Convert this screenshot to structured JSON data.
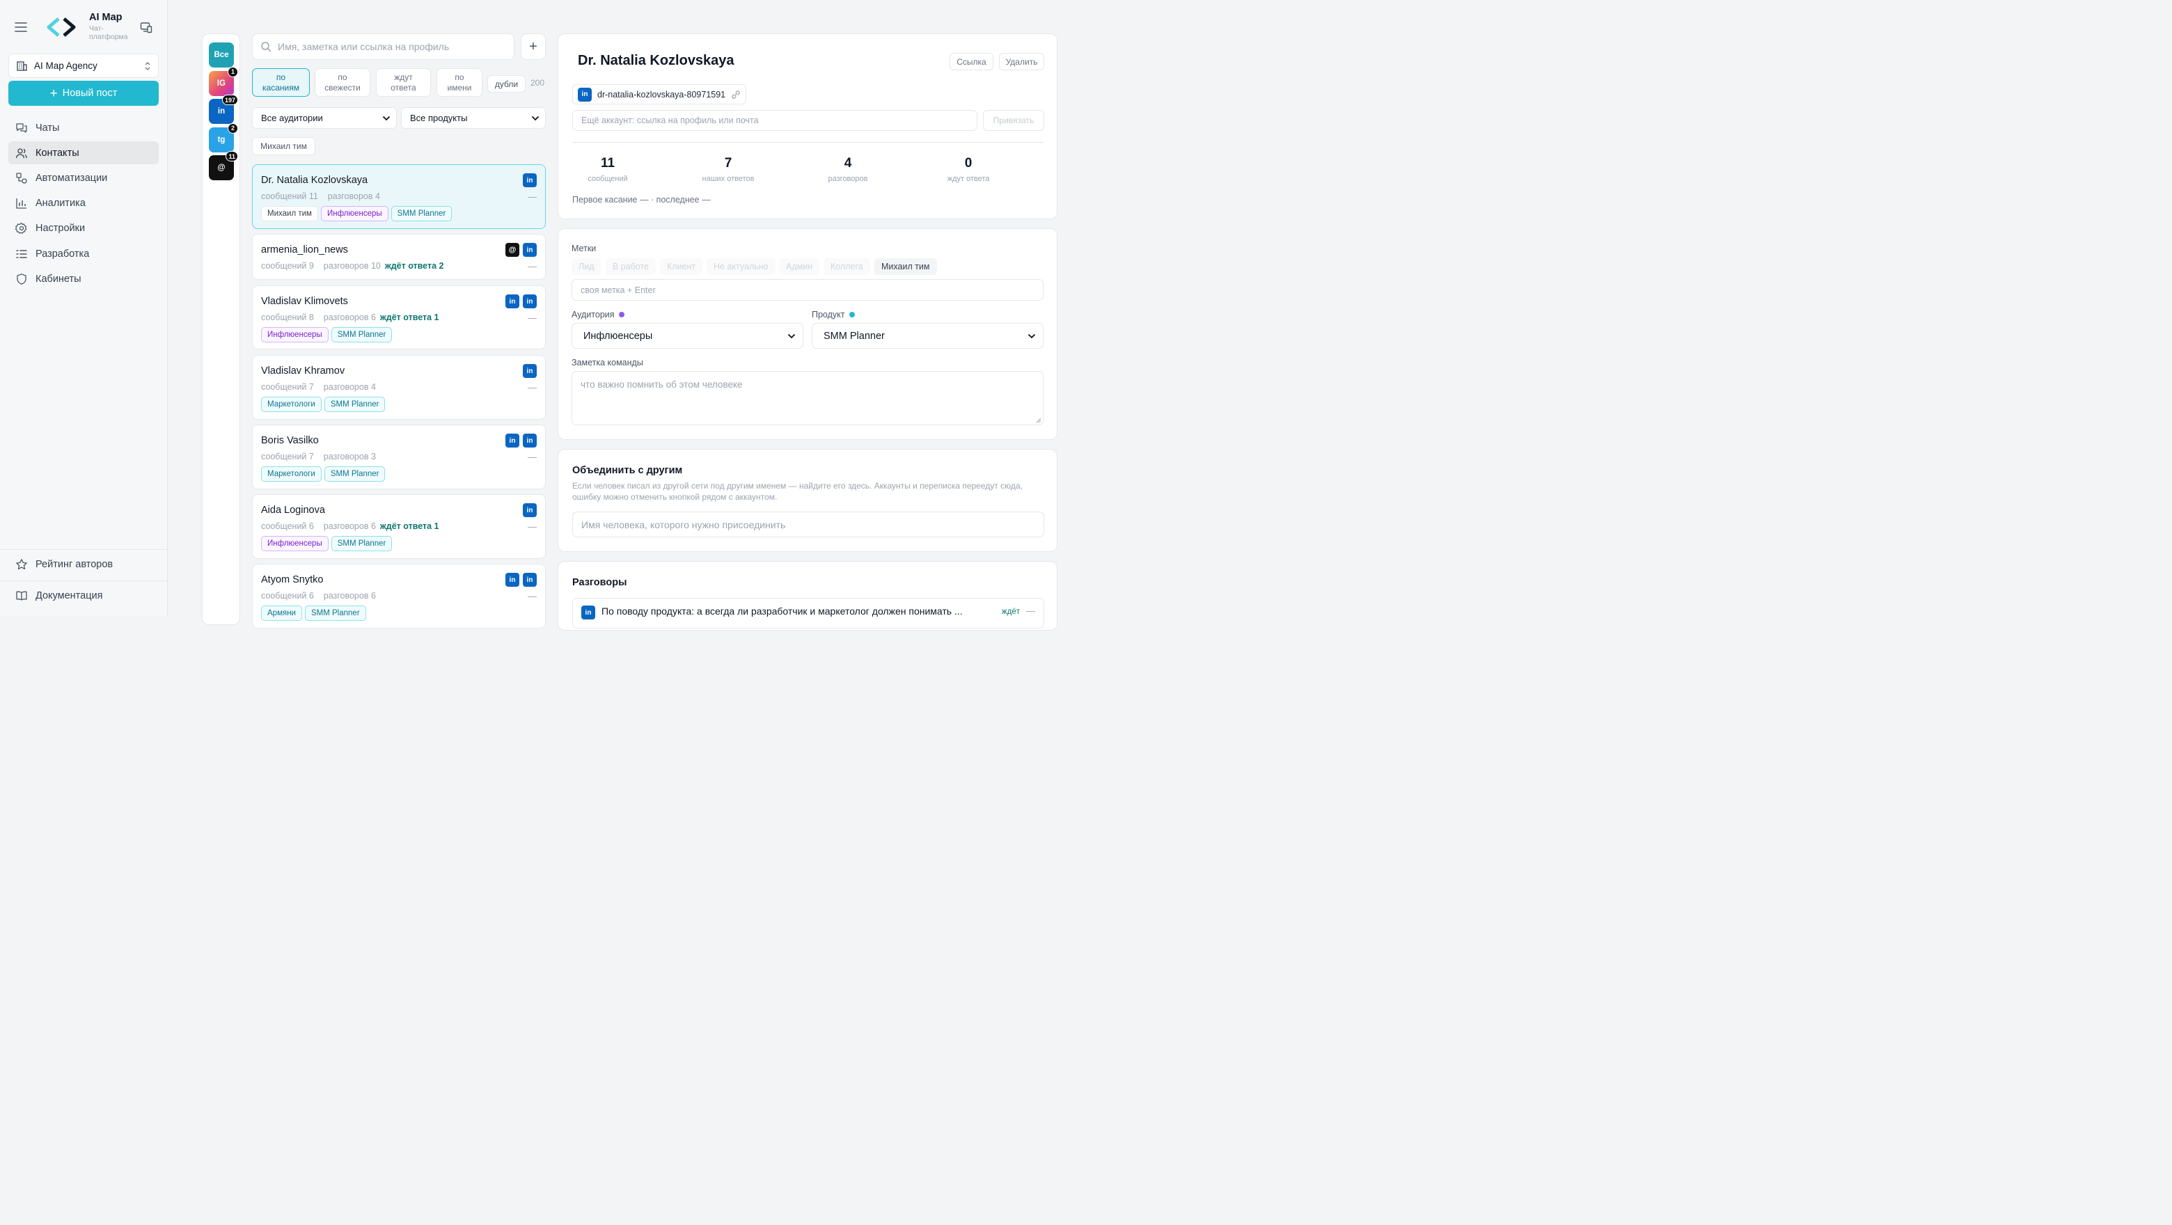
{
  "app": {
    "title": "AI Map",
    "subtitle": "Чат-\nплатформа",
    "workspace": "AI Map Agency",
    "new_post": "Новый пост"
  },
  "nav": [
    {
      "label": "Чаты",
      "icon": "chats-icon",
      "active": false
    },
    {
      "label": "Контакты",
      "icon": "contacts-icon",
      "active": true
    },
    {
      "label": "Автоматизации",
      "icon": "automation-icon",
      "active": false
    },
    {
      "label": "Аналитика",
      "icon": "analytics-icon",
      "active": false
    },
    {
      "label": "Настройки",
      "icon": "gear-icon",
      "active": false
    },
    {
      "label": "Разработка",
      "icon": "dev-icon",
      "active": false
    },
    {
      "label": "Кабинеты",
      "icon": "shield-icon",
      "active": false
    }
  ],
  "footer_nav": [
    {
      "label": "Рейтинг авторов",
      "icon": "star-icon"
    },
    {
      "label": "Документация",
      "icon": "book-icon"
    }
  ],
  "channels": [
    {
      "label": "Все",
      "color": "#1fa2b4",
      "badge": ""
    },
    {
      "label": "IG",
      "color": "#e85a6a",
      "badge": "1"
    },
    {
      "label": "in",
      "color": "#0a66c2",
      "badge": "197"
    },
    {
      "label": "tg",
      "color": "#2aa3e6",
      "badge": "2"
    },
    {
      "label": "@",
      "color": "#111111",
      "badge": "11"
    }
  ],
  "search": {
    "placeholder": "Имя, заметка или ссылка на профиль",
    "add": "+"
  },
  "sort": {
    "options": [
      "по\nкасаниям",
      "по\nсвежести",
      "ждут\nответа",
      "по\nимени"
    ],
    "dupes": "дубли",
    "count": "200"
  },
  "filters": {
    "audience": "Все аудитории",
    "product": "Все продукты",
    "team_tag": "Михаил тим"
  },
  "contacts": [
    {
      "name": "Dr. Natalia Kozlovskaya",
      "messages": "сообщений 11",
      "dialogs": "разговоров 4",
      "waiting": "",
      "icons": [
        "li"
      ],
      "tags": [
        {
          "t": "Михаил тим",
          "c": ""
        },
        {
          "t": "Инфлюенсеры",
          "c": "purple"
        },
        {
          "t": "SMM Planner",
          "c": "teal"
        }
      ]
    },
    {
      "name": "armenia_lion_news",
      "messages": "сообщений 9",
      "dialogs": "разговоров 10",
      "waiting": "ждёт ответа 2",
      "icons": [
        "th",
        "li"
      ],
      "tags": []
    },
    {
      "name": "Vladislav Klimovets",
      "messages": "сообщений 8",
      "dialogs": "разговоров 6",
      "waiting": "ждёт ответа 1",
      "icons": [
        "li",
        "li"
      ],
      "tags": [
        {
          "t": "Инфлюенсеры",
          "c": "purple"
        },
        {
          "t": "SMM Planner",
          "c": "teal"
        }
      ]
    },
    {
      "name": "Vladislav Khramov",
      "messages": "сообщений 7",
      "dialogs": "разговоров 4",
      "waiting": "",
      "icons": [
        "li"
      ],
      "tags": [
        {
          "t": "Маркетологи",
          "c": "teal"
        },
        {
          "t": "SMM Planner",
          "c": "teal"
        }
      ]
    },
    {
      "name": "Boris Vasilko",
      "messages": "сообщений 7",
      "dialogs": "разговоров 3",
      "waiting": "",
      "icons": [
        "li",
        "li"
      ],
      "tags": [
        {
          "t": "Маркетологи",
          "c": "teal"
        },
        {
          "t": "SMM Planner",
          "c": "teal"
        }
      ]
    },
    {
      "name": "Aida Loginova",
      "messages": "сообщений 6",
      "dialogs": "разговоров 6",
      "waiting": "ждёт ответа 1",
      "icons": [
        "li"
      ],
      "tags": [
        {
          "t": "Инфлюенсеры",
          "c": "purple"
        },
        {
          "t": "SMM Planner",
          "c": "teal"
        }
      ]
    },
    {
      "name": "Atyom Snytko",
      "messages": "сообщений 6",
      "dialogs": "разговоров 6",
      "waiting": "",
      "icons": [
        "li",
        "li"
      ],
      "tags": [
        {
          "t": "Армяни",
          "c": "teal"
        },
        {
          "t": "SMM Planner",
          "c": "teal"
        }
      ]
    }
  ],
  "detail": {
    "name": "Dr. Natalia Kozlovskaya",
    "link_btn": "Ссылка",
    "delete_btn": "Удалить",
    "account": "dr-natalia-kozlovskaya-80971591",
    "add_account_placeholder": "Ещё аккаунт: ссылка на профиль или почта",
    "bind_btn": "Привязать",
    "stats": [
      {
        "n": "11",
        "l": "сообщений"
      },
      {
        "n": "7",
        "l": "наших ответов"
      },
      {
        "n": "4",
        "l": "разговоров"
      },
      {
        "n": "0",
        "l": "ждут ответа"
      }
    ],
    "first_touch": "Первое касание — · последнее —"
  },
  "tags_panel": {
    "title": "Метки",
    "tags": [
      {
        "t": "Лид",
        "on": false
      },
      {
        "t": "В работе",
        "on": false
      },
      {
        "t": "Клиент",
        "on": false
      },
      {
        "t": "Не актуально",
        "on": false
      },
      {
        "t": "Админ",
        "on": false
      },
      {
        "t": "Коллега",
        "on": false
      },
      {
        "t": "Михаил тим",
        "on": true
      }
    ],
    "custom_placeholder": "своя метка + Enter",
    "audience_label": "Аудитория",
    "audience_value": "Инфлюенсеры",
    "audience_dot": "#8b5cf6",
    "product_label": "Продукт",
    "product_value": "SMM Planner",
    "product_dot": "#22b8cf",
    "note_label": "Заметка команды",
    "note_placeholder": "что важно помнить об этом человеке"
  },
  "merge": {
    "title": "Объединить с другим",
    "desc": "Если человек писал из другой сети под другим именем — найдите его здесь. Аккаунты и переписка переедут сюда, ошибку можно отменить кнопкой рядом с аккаунтом.",
    "placeholder": "Имя человека, которого нужно присоединить"
  },
  "conversations": {
    "title": "Разговоры",
    "items": [
      {
        "text": "По поводу продукта: а всегда ли разработчик и маркетолог должен понимать ...",
        "status": "ждёт"
      }
    ]
  }
}
